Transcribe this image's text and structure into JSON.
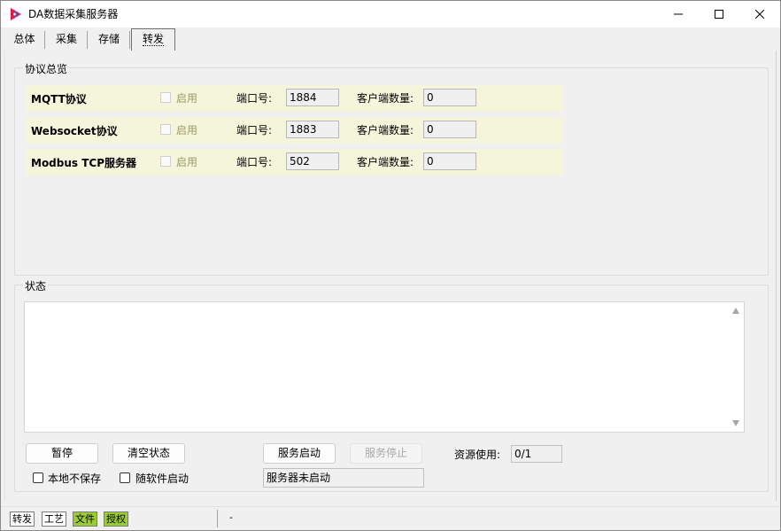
{
  "window": {
    "title": "DA数据采集服务器",
    "colors": {
      "icon_red": "#e8194a",
      "icon_blue": "#2a5bd7",
      "row_bg": "#f5f5dc",
      "status_green": "#9acd32"
    }
  },
  "tabs": [
    {
      "label": "总体"
    },
    {
      "label": "采集"
    },
    {
      "label": "存储"
    },
    {
      "label": "转发",
      "active": true
    }
  ],
  "protocol_group": {
    "title": "协议总览",
    "rows": [
      {
        "name": "MQTT协议",
        "enable_label": "启用",
        "enabled": false,
        "port_label": "端口号:",
        "port": "1884",
        "clients_label": "客户端数量:",
        "clients": "0"
      },
      {
        "name": "Websocket协议",
        "enable_label": "启用",
        "enabled": false,
        "port_label": "端口号:",
        "port": "1883",
        "clients_label": "客户端数量:",
        "clients": "0"
      },
      {
        "name": "Modbus TCP服务器",
        "enable_label": "启用",
        "enabled": false,
        "port_label": "端口号:",
        "port": "502",
        "clients_label": "客户端数量:",
        "clients": "0"
      }
    ]
  },
  "status_group": {
    "title": "状态",
    "log_text": ""
  },
  "controls": {
    "pause_label": "暂停",
    "clear_label": "清空状态",
    "start_label": "服务启动",
    "stop_label": "服务停止",
    "resource_label": "资源使用:",
    "resource_value": "0/1",
    "no_local_save_label": "本地不保存",
    "no_local_save_checked": false,
    "autostart_label": "随软件启动",
    "autostart_checked": false,
    "server_status": "服务器未启动"
  },
  "statusbar": {
    "items": [
      "转发",
      "工艺",
      "文件",
      "授权"
    ],
    "text": "-"
  }
}
